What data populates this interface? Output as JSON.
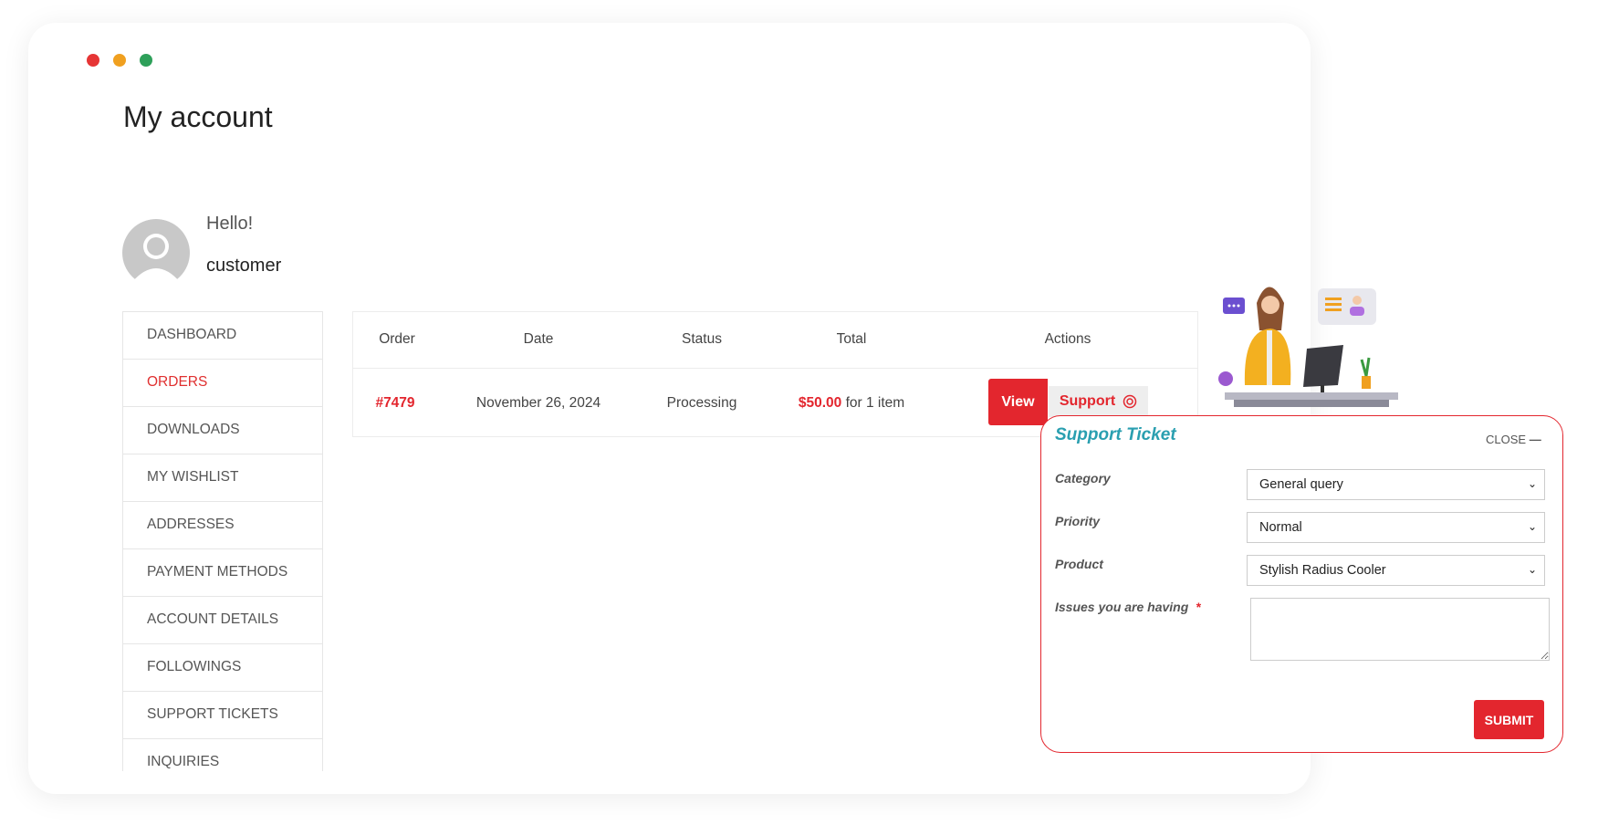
{
  "window": {
    "dots": [
      "#e63535",
      "#f0a020",
      "#2ea05a"
    ]
  },
  "page": {
    "title": "My account"
  },
  "user": {
    "greeting": "Hello!",
    "name": "customer"
  },
  "sidebar": {
    "items": [
      {
        "label": "DASHBOARD",
        "active": false
      },
      {
        "label": "ORDERS",
        "active": true
      },
      {
        "label": "DOWNLOADS",
        "active": false
      },
      {
        "label": "MY WISHLIST",
        "active": false
      },
      {
        "label": "ADDRESSES",
        "active": false
      },
      {
        "label": "PAYMENT METHODS",
        "active": false
      },
      {
        "label": "ACCOUNT DETAILS",
        "active": false
      },
      {
        "label": "FOLLOWINGS",
        "active": false
      },
      {
        "label": "SUPPORT TICKETS",
        "active": false
      },
      {
        "label": "INQUIRIES",
        "active": false
      }
    ]
  },
  "orders": {
    "headers": [
      "Order",
      "Date",
      "Status",
      "Total",
      "Actions"
    ],
    "rows": [
      {
        "order": "#7479",
        "date": "November 26, 2024",
        "status": "Processing",
        "total": "$50.00",
        "total_suffix": "for 1 item",
        "view": "View",
        "support": "Support"
      }
    ]
  },
  "ticket": {
    "title": "Support Ticket",
    "close": "CLOSE",
    "category_label": "Category",
    "category_value": "General query",
    "priority_label": "Priority",
    "priority_value": "Normal",
    "product_label": "Product",
    "product_value": "Stylish Radius Cooler",
    "issues_label": "Issues you are having",
    "required_mark": "*",
    "issues_value": "",
    "submit": "SUBMIT"
  },
  "colors": {
    "accent": "#e3262e",
    "title_teal": "#2a9fb0"
  }
}
